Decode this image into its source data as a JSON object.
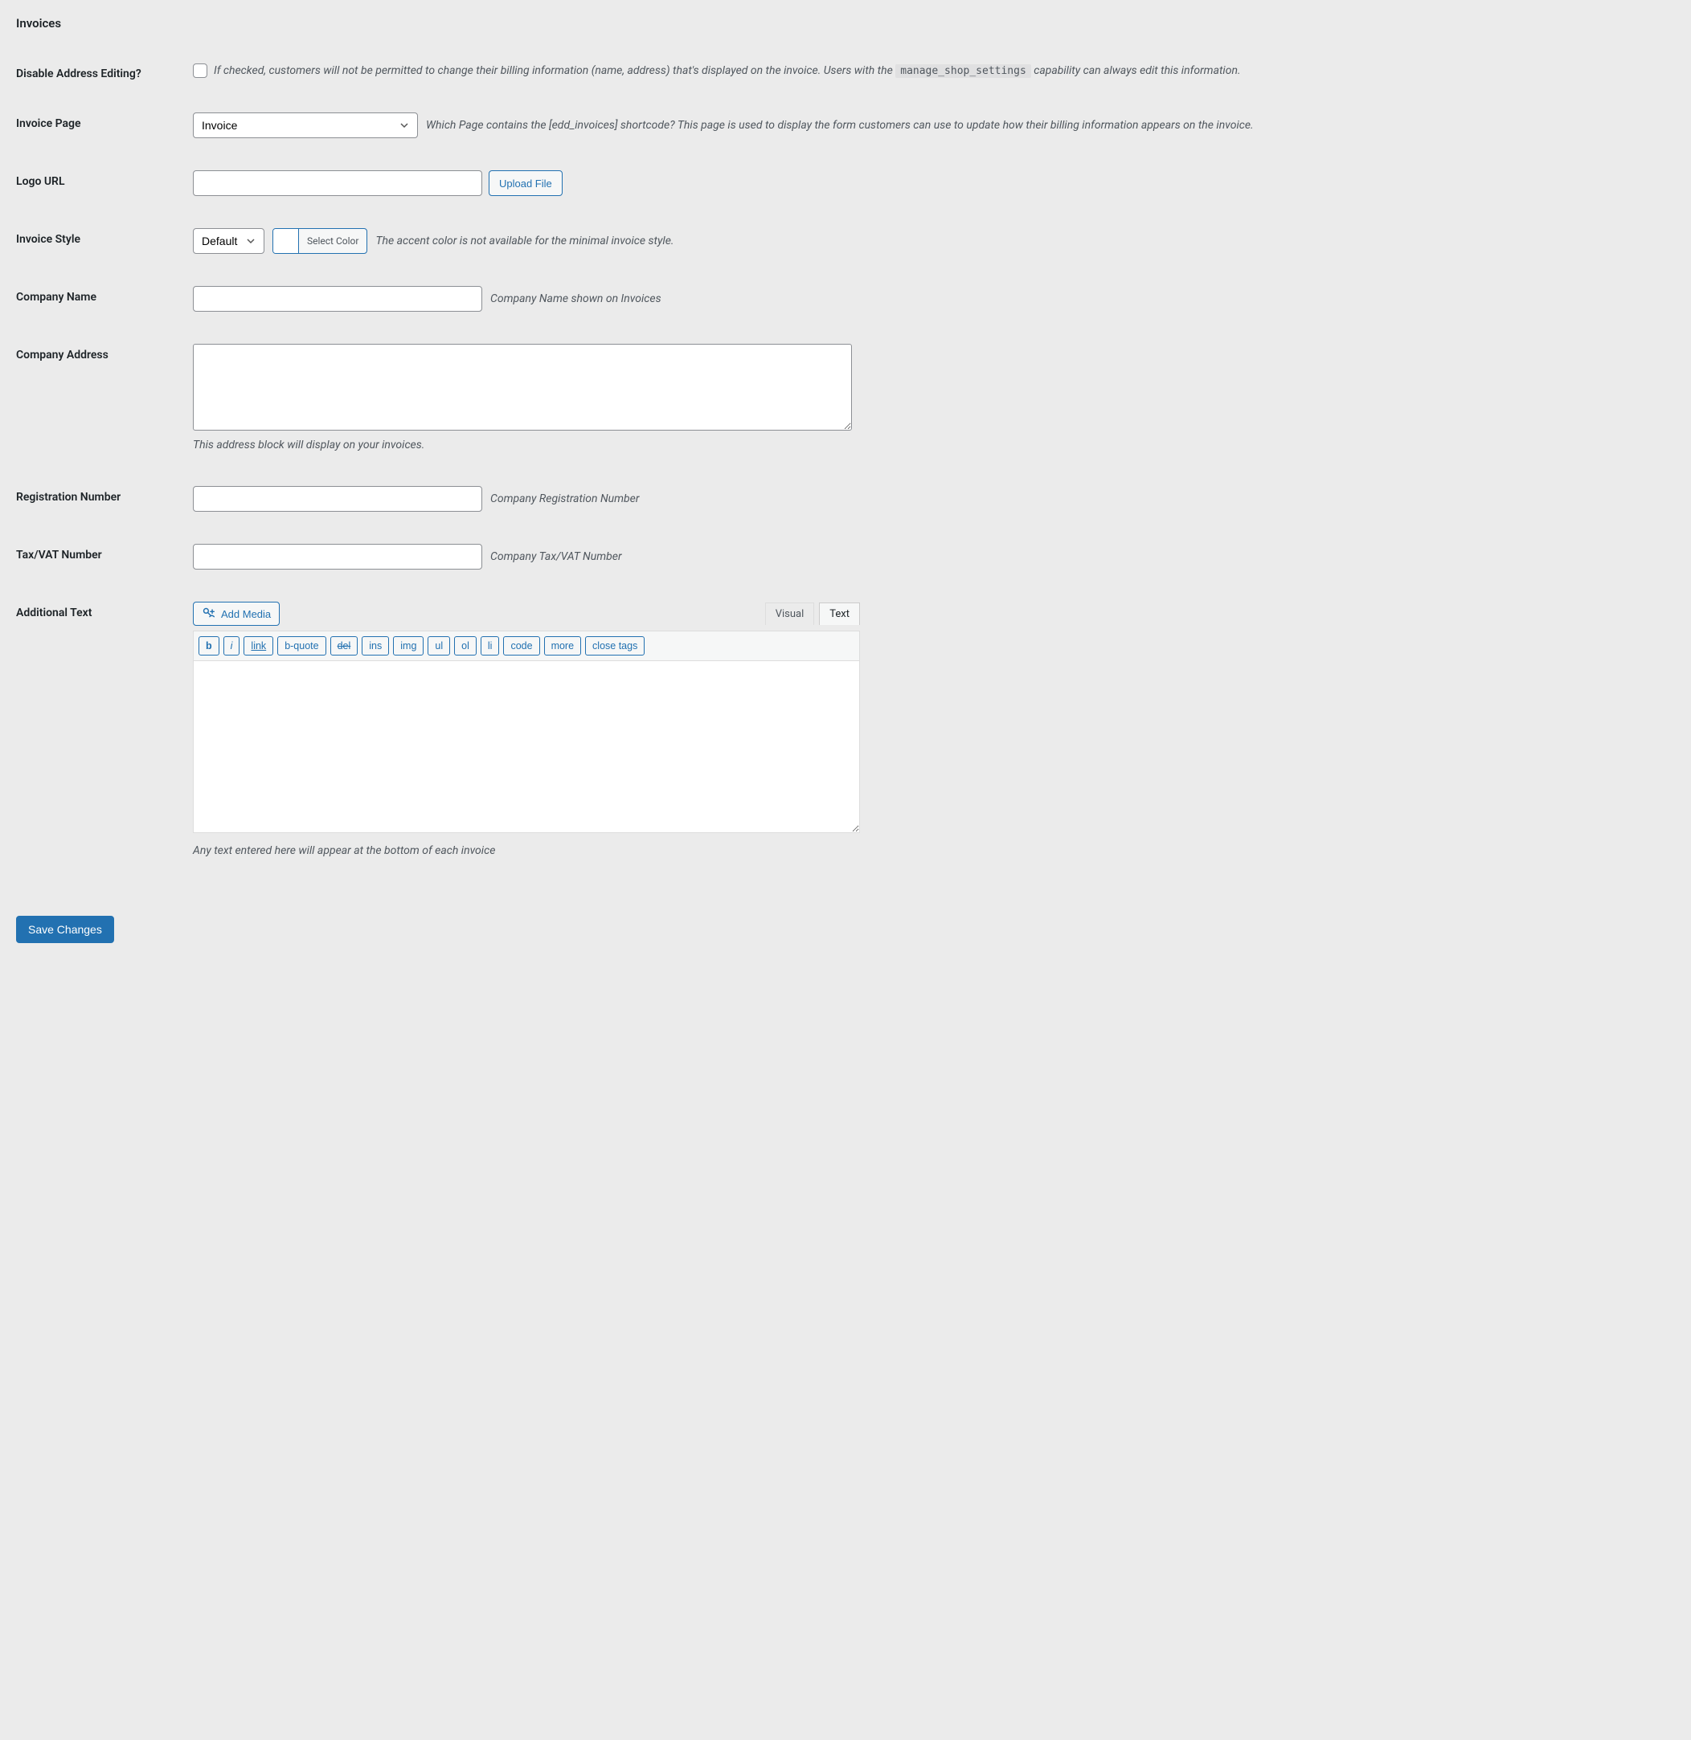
{
  "section_title": "Invoices",
  "disable_address": {
    "label": "Disable Address Editing?",
    "desc_before": "If checked, customers will not be permitted to change their billing information (name, address) that's displayed on the invoice. Users with the ",
    "code": "manage_shop_settings",
    "desc_after": " capability can always edit this information."
  },
  "invoice_page": {
    "label": "Invoice Page",
    "selected": "Invoice",
    "desc": "Which Page contains the [edd_invoices] shortcode? This page is used to display the form customers can use to update how their billing information appears on the invoice."
  },
  "logo_url": {
    "label": "Logo URL",
    "upload_btn": "Upload File"
  },
  "invoice_style": {
    "label": "Invoice Style",
    "selected": "Default",
    "color_btn": "Select Color",
    "desc": "The accent color is not available for the minimal invoice style."
  },
  "company_name": {
    "label": "Company Name",
    "desc": "Company Name shown on Invoices"
  },
  "company_address": {
    "label": "Company Address",
    "desc": "This address block will display on your invoices."
  },
  "registration": {
    "label": "Registration Number",
    "desc": "Company Registration Number"
  },
  "tax_vat": {
    "label": "Tax/VAT Number",
    "desc": "Company Tax/VAT Number"
  },
  "additional_text": {
    "label": "Additional Text",
    "add_media": "Add Media",
    "tab_visual": "Visual",
    "tab_text": "Text",
    "buttons": [
      "b",
      "i",
      "link",
      "b-quote",
      "del",
      "ins",
      "img",
      "ul",
      "ol",
      "li",
      "code",
      "more",
      "close tags"
    ],
    "desc": "Any text entered here will appear at the bottom of each invoice"
  },
  "save_button": "Save Changes"
}
